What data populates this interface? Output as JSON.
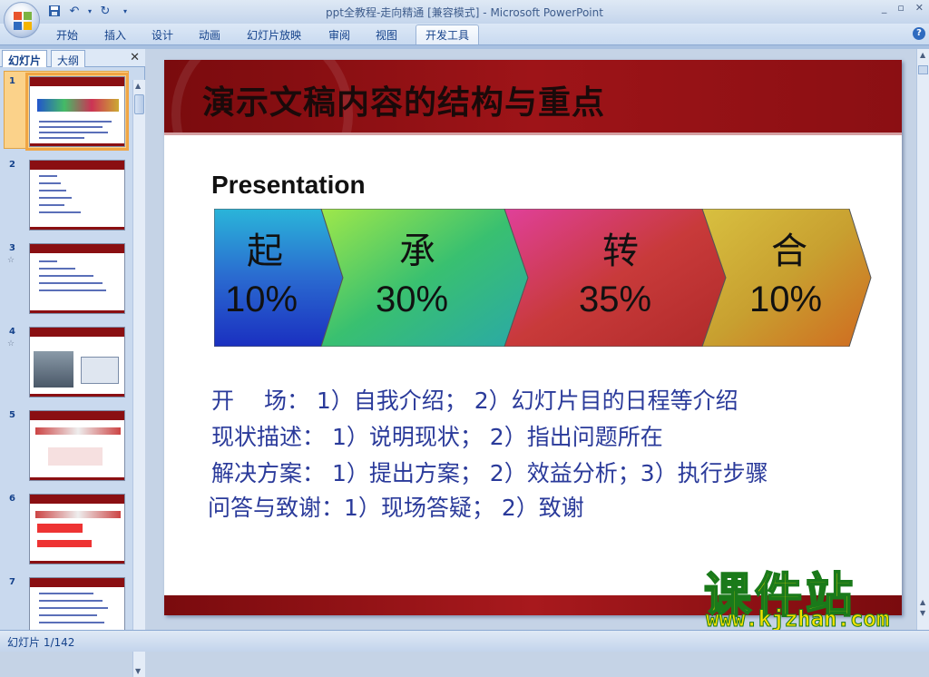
{
  "window": {
    "title": "ppt全教程-走向精通 [兼容模式] - Microsoft PowerPoint",
    "controls": [
      "_",
      "▫",
      "✕"
    ]
  },
  "ribbon": {
    "tabs": [
      "开始",
      "插入",
      "设计",
      "动画",
      "幻灯片放映",
      "审阅",
      "视图",
      "开发工具"
    ],
    "active_tab": "开发工具"
  },
  "panel": {
    "tabs": [
      "幻灯片",
      "大纲"
    ],
    "close": "✕",
    "thumbnails": [
      {
        "num": "1",
        "star": ""
      },
      {
        "num": "2",
        "star": ""
      },
      {
        "num": "3",
        "star": "☆"
      },
      {
        "num": "4",
        "star": "☆"
      },
      {
        "num": "5",
        "star": ""
      },
      {
        "num": "6",
        "star": ""
      },
      {
        "num": "7",
        "star": ""
      }
    ]
  },
  "slide": {
    "title": "演示文稿内容的结构与重点",
    "subtitle": "Presentation",
    "segments": [
      {
        "char": "起",
        "pct": "10%"
      },
      {
        "char": "承",
        "pct": "30%"
      },
      {
        "char": "转",
        "pct": "35%"
      },
      {
        "char": "合",
        "pct": "10%"
      }
    ],
    "lines": [
      "开　 场： 1）自我介绍； 2）幻灯片目的日程等介绍",
      "现状描述： 1）说明现状； 2）指出问题所在",
      "解决方案： 1）提出方案； 2）效益分析；3）执行步骤",
      "问答与致谢：1）现场答疑； 2）致谢"
    ]
  },
  "watermark": {
    "cn": "课件站",
    "url": "www.kjzhan.com"
  },
  "status": {
    "slide_info": "幻灯片 1/142"
  },
  "colors": {
    "header_red": "#8a0f12",
    "text_blue": "#2a3a9a",
    "ribbon_blue": "#c9daf0"
  }
}
